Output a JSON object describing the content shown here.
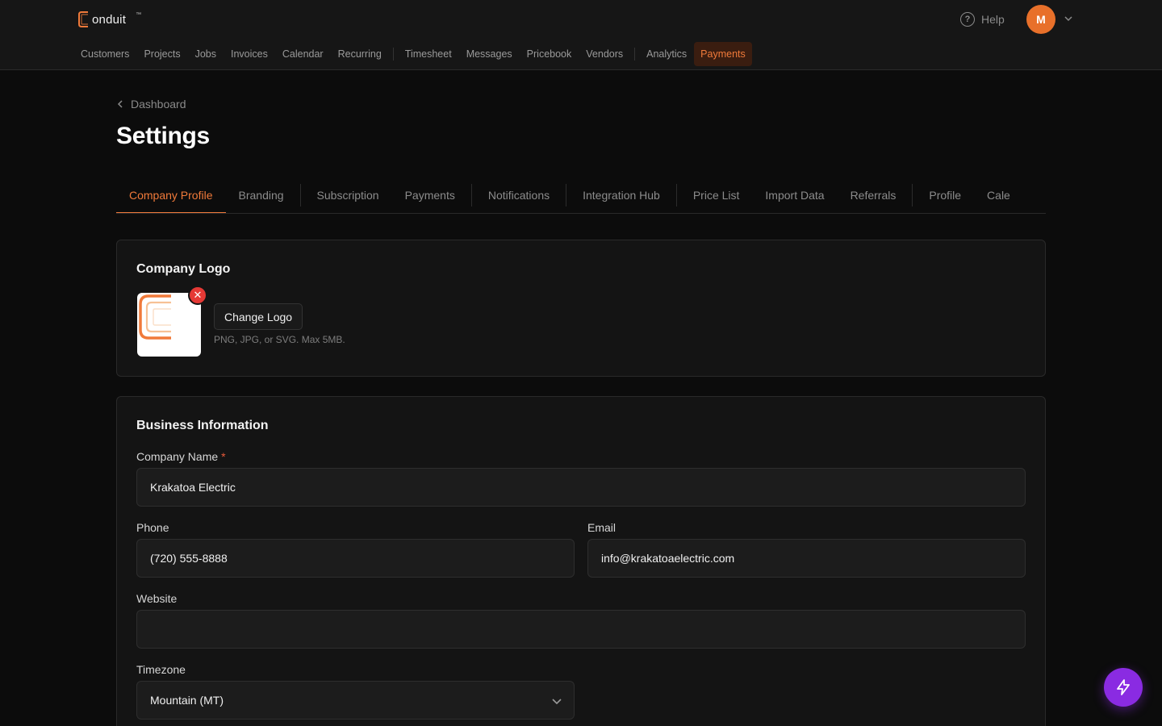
{
  "brand": {
    "name": "onduit",
    "tm": "™",
    "accent": "#f07a3a"
  },
  "header": {
    "help_label": "Help",
    "avatar_initial": "M"
  },
  "topnav": {
    "group1": [
      "Customers",
      "Projects",
      "Jobs",
      "Invoices",
      "Calendar",
      "Recurring"
    ],
    "group2": [
      "Timesheet",
      "Messages",
      "Pricebook",
      "Vendors"
    ],
    "group3": [
      "Analytics",
      "Payments"
    ],
    "active": "Payments"
  },
  "breadcrumb": {
    "label": "Dashboard"
  },
  "page": {
    "title": "Settings"
  },
  "tabs": {
    "items": [
      "Company Profile",
      "Branding",
      "Subscription",
      "Payments",
      "Notifications",
      "Integration Hub",
      "Price List",
      "Import Data",
      "Referrals",
      "Profile",
      "Cale"
    ],
    "active": "Company Profile"
  },
  "logo_card": {
    "title": "Company Logo",
    "change_label": "Change Logo",
    "hint": "PNG, JPG, or SVG. Max 5MB."
  },
  "business": {
    "title": "Business Information",
    "company_name": {
      "label": "Company Name",
      "required": "*",
      "value": "Krakatoa Electric"
    },
    "phone": {
      "label": "Phone",
      "value": "(720) 555-8888"
    },
    "email": {
      "label": "Email",
      "value": "info@krakatoaelectric.com"
    },
    "website": {
      "label": "Website",
      "value": ""
    },
    "timezone": {
      "label": "Timezone",
      "value": "Mountain (MT)"
    }
  }
}
